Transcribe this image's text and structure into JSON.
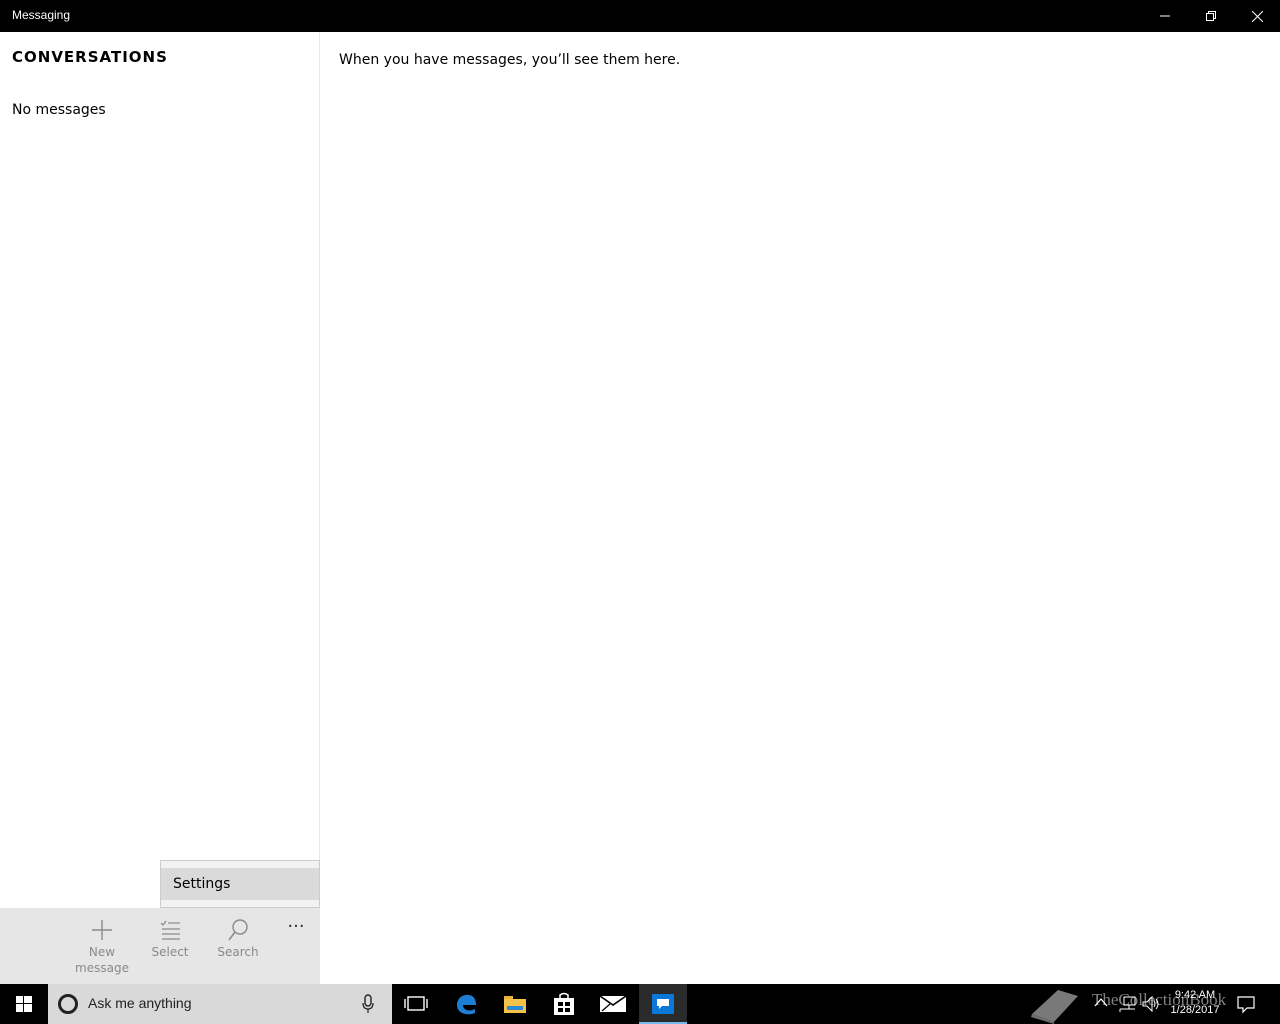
{
  "window": {
    "title": "Messaging",
    "controls": {
      "minimize": "minimize-icon",
      "maximize": "restore-icon",
      "close": "close-icon"
    }
  },
  "sidebar": {
    "header": "CONVERSATIONS",
    "empty_text": "No messages"
  },
  "flyout": {
    "items": [
      {
        "label": "Settings"
      }
    ]
  },
  "commandbar": {
    "new_message": {
      "line1": "New",
      "line2": "message",
      "icon": "plus-icon"
    },
    "select": {
      "label": "Select",
      "icon": "select-list-icon"
    },
    "search": {
      "label": "Search",
      "icon": "search-icon"
    },
    "more": {
      "label": "···",
      "icon": "more-icon"
    }
  },
  "main": {
    "empty_text": "When you have messages, you’ll see them here."
  },
  "taskbar": {
    "search_placeholder": "Ask me anything",
    "pinned": [
      "task-view-icon",
      "edge-icon",
      "file-explorer-icon",
      "store-icon",
      "mail-icon",
      "messaging-icon"
    ],
    "watermark": "TheCollectionBook",
    "clock": {
      "time": "9:42 AM",
      "date": "1/28/2017"
    }
  },
  "colors": {
    "titlebar": "#000000",
    "commandbar": "#e6e6e6",
    "flyout_hover": "#dadada",
    "taskbar": "#000000",
    "accent": "#0078d7"
  }
}
